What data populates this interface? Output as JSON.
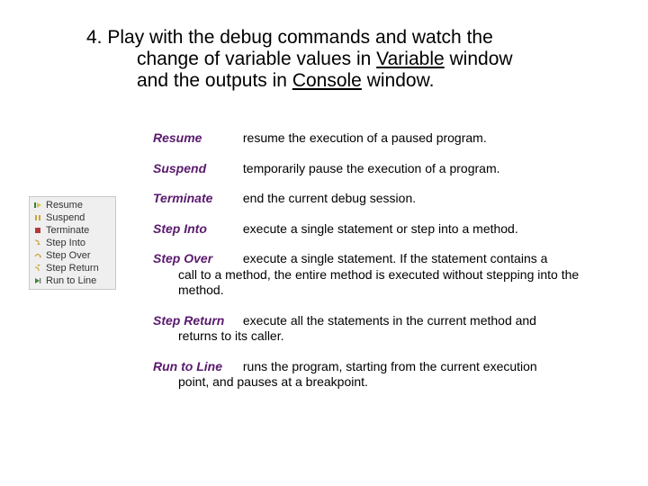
{
  "heading": {
    "line1": "4. Play with the debug commands and watch the",
    "line2_a": "change of variable values in ",
    "line2_var": "Variable",
    "line2_b": " window",
    "line3_a": "and the outputs in ",
    "line3_con": "Console",
    "line3_b": " window."
  },
  "menu": {
    "items": [
      {
        "icon": "resume",
        "label": "Resume"
      },
      {
        "icon": "suspend",
        "label": "Suspend"
      },
      {
        "icon": "terminate",
        "label": "Terminate"
      },
      {
        "icon": "step-into",
        "label": "Step Into"
      },
      {
        "icon": "step-over",
        "label": "Step Over"
      },
      {
        "icon": "step-return",
        "label": "Step Return"
      },
      {
        "icon": "run-to-line",
        "label": "Run to Line"
      }
    ]
  },
  "definitions": [
    {
      "term": "Resume",
      "desc": "resume the execution of a paused program."
    },
    {
      "term": "Suspend",
      "desc": "temporarily pause the execution of a program."
    },
    {
      "term": "Terminate",
      "desc": "end the current debug session."
    },
    {
      "term": "Step Into",
      "desc": "execute a single statement or step into a method."
    },
    {
      "term": "Step Over",
      "desc": "execute a single statement. If the statement contains a call to a method, the entire method is executed without stepping into the method."
    },
    {
      "term": "Step Return",
      "desc": "execute all the statements in the current method and returns to its caller."
    },
    {
      "term": "Run to Line",
      "desc": "runs the program, starting from the current execution point, and pauses at a breakpoint."
    }
  ]
}
